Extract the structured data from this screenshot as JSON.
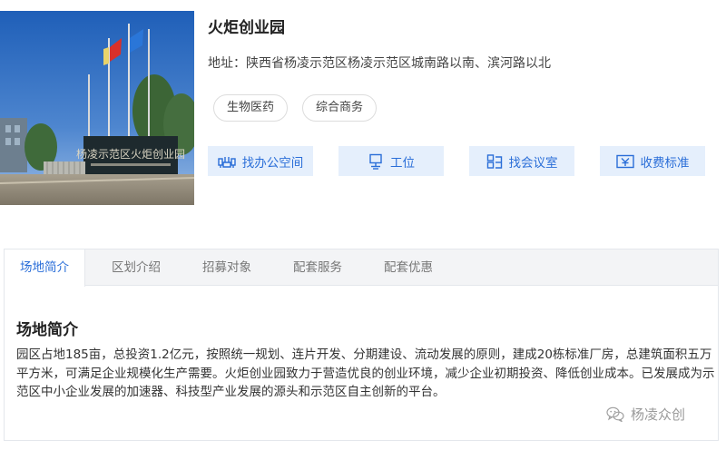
{
  "park": {
    "name": "火炬创业园",
    "address": "地址：陕西省杨凌示范区杨凌示范区城南路以南、滨河路以北",
    "photo_sign_text": "杨凌示范区火炬创业园",
    "tags": [
      "生物医药",
      "综合商务"
    ]
  },
  "actions": [
    {
      "label": "找办公空间",
      "icon": "office-icon"
    },
    {
      "label": "工位",
      "icon": "workstation-icon"
    },
    {
      "label": "找会议室",
      "icon": "meeting-room-icon"
    },
    {
      "label": "收费标准",
      "icon": "fee-icon"
    }
  ],
  "tabs": [
    {
      "label": "场地简介",
      "active": true
    },
    {
      "label": "区划介绍",
      "active": false
    },
    {
      "label": "招募对象",
      "active": false
    },
    {
      "label": "配套服务",
      "active": false
    },
    {
      "label": "配套优惠",
      "active": false
    }
  ],
  "section": {
    "title": "场地简介",
    "body": "园区占地185亩，总投资1.2亿元，按照统一规划、连片开发、分期建设、流动发展的原则，建成20栋标准厂房，总建筑面积五万平方米，可满足企业规模化生产需要。火炬创业园致力于营造优良的创业环境，减少企业初期投资、降低创业成本。已发展成为示范区中小企业发展的加速器、科技型产业发展的源头和示范区自主创新的平台。"
  },
  "watermark": {
    "text": "杨凌众创",
    "icon": "wechat-icon"
  },
  "colors": {
    "accent": "#2a6ed8",
    "button_bg": "#e5effc",
    "tab_bg": "#f3f4f6",
    "border": "#e4e7ec"
  }
}
